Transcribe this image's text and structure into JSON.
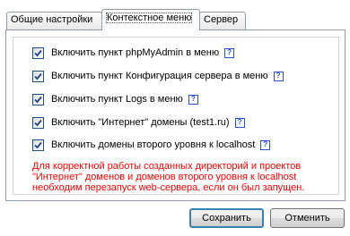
{
  "tabs": [
    {
      "label": "Общие настройки",
      "active": false
    },
    {
      "label": "Контекстное меню",
      "active": true
    },
    {
      "label": "Сервер",
      "active": false
    }
  ],
  "options": [
    {
      "label": "Включить пункт phpMyAdmin в меню",
      "checked": true,
      "help": "?"
    },
    {
      "label": "Включить пункт Конфигурация сервера в меню",
      "checked": true,
      "help": "?"
    },
    {
      "label": "Включить пункт Logs в меню",
      "checked": true,
      "help": "?"
    },
    {
      "label": "Включить \"Интернет\" домены (test1.ru)",
      "checked": true,
      "help": "?"
    },
    {
      "label": "Включить домены второго уровня к localhost",
      "checked": true,
      "help": "?"
    }
  ],
  "note": "Для корректной работы созданных директорий и проектов \"Интернет\" доменов и доменов второго уровня к localhost необходим перезапуск web-сервера, если он был запущен.",
  "buttons": {
    "save": "Сохранить",
    "cancel": "Отменить"
  },
  "colors": {
    "note": "#ff0000",
    "help_icon": "#2a4fd0",
    "checkbox_border": "#1c5180"
  }
}
